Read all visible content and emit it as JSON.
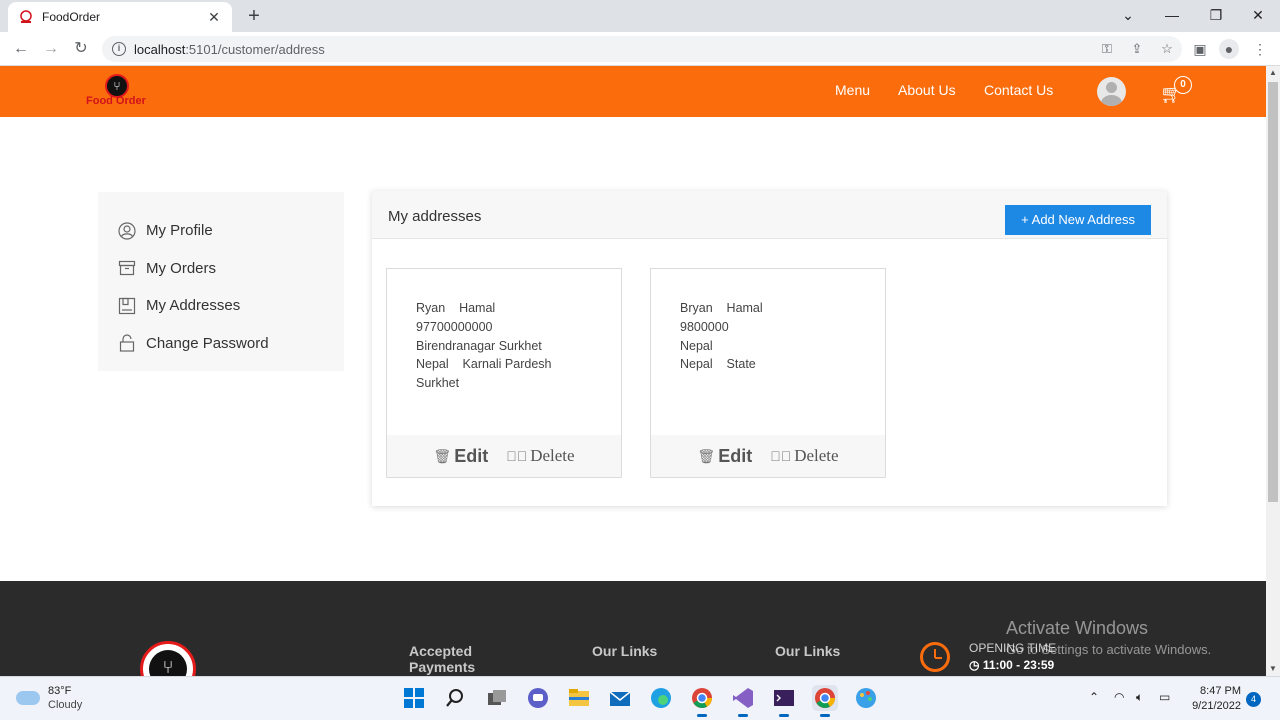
{
  "browser": {
    "tab_title": "FoodOrder",
    "tab_close": "✕",
    "new_tab": "+",
    "url_host": "localhost",
    "url_path": ":5101/customer/address",
    "window_controls": [
      "⌄",
      "—",
      "❐",
      "✕"
    ]
  },
  "header": {
    "logo_text": "Food Order",
    "nav": [
      "Menu",
      "About Us",
      "Contact Us"
    ],
    "cart_count": "0",
    "brand_color": "#fb6c0c"
  },
  "sidebar": {
    "items": [
      {
        "label": "My Profile",
        "icon": "user-circle-icon"
      },
      {
        "label": "My Orders",
        "icon": "archive-box-icon"
      },
      {
        "label": "My Addresses",
        "icon": "address-book-icon"
      },
      {
        "label": "Change Password",
        "icon": "lock-icon"
      }
    ]
  },
  "panel": {
    "title": "My addresses",
    "add_button": "+ Add New Address",
    "addresses": [
      {
        "lines": [
          "Ryan    Hamal",
          "97700000000",
          "Birendranagar Surkhet",
          "Nepal    Karnali Pardesh",
          "Surkhet"
        ],
        "edit": "Edit",
        "delete": "Delete"
      },
      {
        "lines": [
          "Bryan    Hamal",
          "9800000",
          "Nepal",
          "Nepal    State"
        ],
        "edit": "Edit",
        "delete": "Delete"
      }
    ]
  },
  "footer": {
    "headings": [
      "Accepted Payments",
      "Our Links",
      "Our Links"
    ],
    "opening_label": "OPENING TIME",
    "opening_time": "11:00 - 23:59",
    "watermark_title": "Activate Windows",
    "watermark_sub": "Go to Settings to activate Windows."
  },
  "taskbar": {
    "temp": "83°F",
    "condition": "Cloudy",
    "time": "8:47 PM",
    "date": "9/21/2022",
    "notifications": "4"
  }
}
